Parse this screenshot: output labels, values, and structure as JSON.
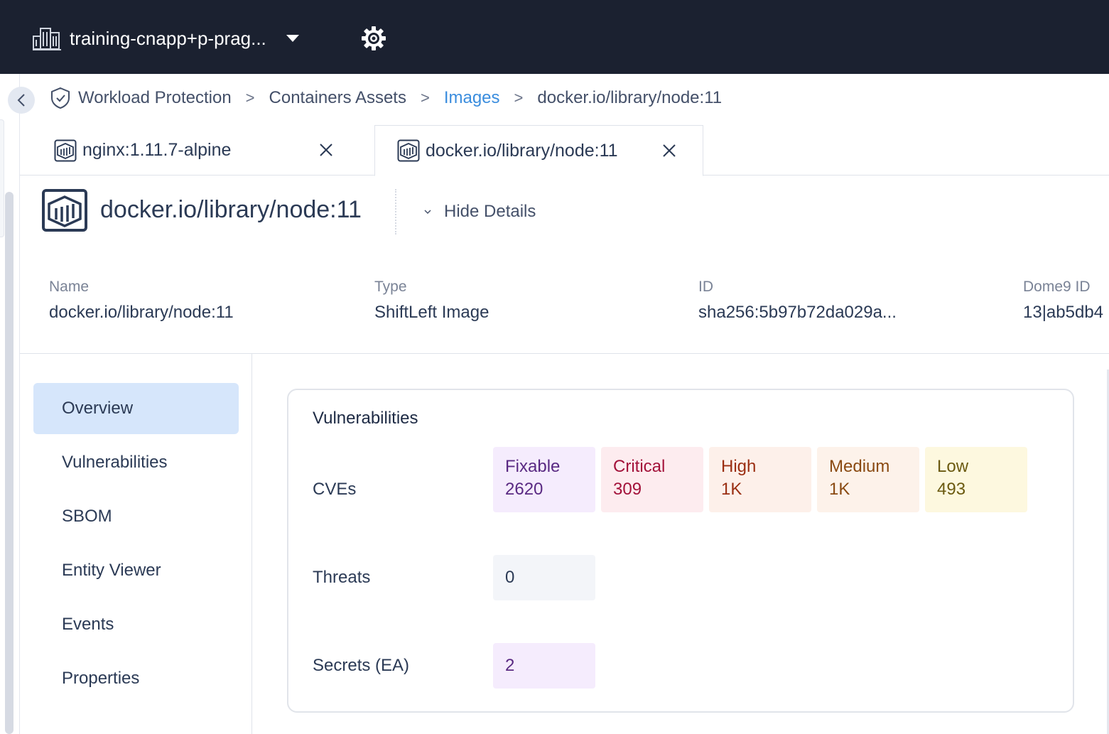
{
  "topbar": {
    "account_name": "training-cnapp+p-prag...",
    "icons": {
      "account": "building-icon",
      "dropdown": "caret-down-icon",
      "settings": "gear-icon"
    }
  },
  "breadcrumb": {
    "items": [
      "Workload Protection",
      "Containers Assets",
      "Images",
      "docker.io/library/node:11"
    ],
    "separator": ">"
  },
  "tabs": [
    {
      "label": "nginx:1.11.7-alpine",
      "active": false
    },
    {
      "label": "docker.io/library/node:11",
      "active": true
    }
  ],
  "entity": {
    "title": "docker.io/library/node:11",
    "hide_details_label": "Hide Details"
  },
  "details": [
    {
      "key": "Name",
      "value": "docker.io/library/node:11"
    },
    {
      "key": "Type",
      "value": "ShiftLeft Image"
    },
    {
      "key": "ID",
      "value": "sha256:5b97b72da029a..."
    },
    {
      "key": "Dome9 ID",
      "value": "13|ab5db4"
    }
  ],
  "sidenav": {
    "items": [
      "Overview",
      "Vulnerabilities",
      "SBOM",
      "Entity Viewer",
      "Events",
      "Properties"
    ],
    "active": "Overview"
  },
  "vulnerabilities": {
    "title": "Vulnerabilities",
    "cves_label": "CVEs",
    "cves": [
      {
        "name": "Fixable",
        "value": "2620",
        "bg": "#f5ecfd",
        "color": "#5a2a83"
      },
      {
        "name": "Critical",
        "value": "309",
        "bg": "#fdecef",
        "color": "#a3123a"
      },
      {
        "name": "High",
        "value": "1K",
        "bg": "#fdf0ea",
        "color": "#9a2e12"
      },
      {
        "name": "Medium",
        "value": "1K",
        "bg": "#fdf2ea",
        "color": "#8a4a12"
      },
      {
        "name": "Low",
        "value": "493",
        "bg": "#fdf8df",
        "color": "#6b5a10"
      }
    ],
    "threats_label": "Threats",
    "threats_value": "0",
    "secrets_label": "Secrets (EA)",
    "secrets_value": "2"
  }
}
